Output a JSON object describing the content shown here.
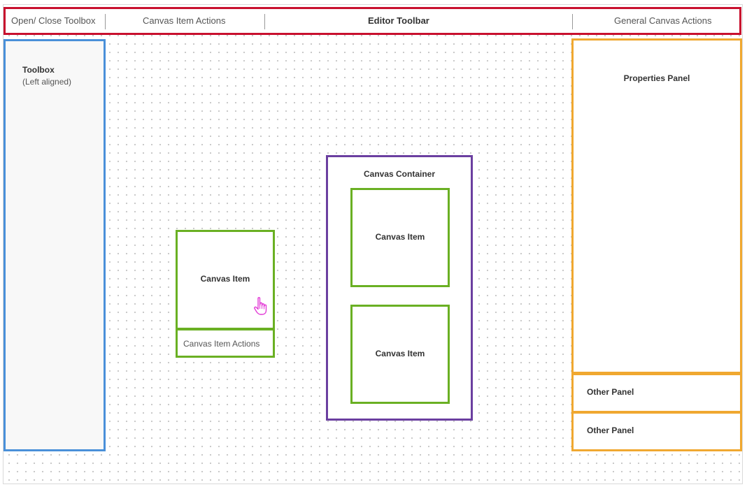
{
  "toolbar": {
    "open_close_toolbox": "Open/ Close Toolbox",
    "canvas_item_actions": "Canvas Item Actions",
    "editor_toolbar": "Editor Toolbar",
    "general_canvas_actions": "General Canvas Actions"
  },
  "toolbox": {
    "title": "Toolbox",
    "subtitle": "(Left aligned)"
  },
  "properties_panel": {
    "title": "Properties Panel"
  },
  "other_panels": [
    "Other Panel",
    "Other Panel"
  ],
  "canvas": {
    "item_label": "Canvas Item",
    "item_actions_label": "Canvas Item Actions",
    "container_title": "Canvas Container",
    "container_items": [
      "Canvas Item",
      "Canvas Item"
    ],
    "cursor_icon": "pointer-hand-icon"
  },
  "colors": {
    "toolbar_border": "#c8102e",
    "toolbox_border": "#4a90d9",
    "panel_border": "#f0a830",
    "item_border": "#6ab023",
    "container_border": "#6b3fa0",
    "cursor": "#e23bd6"
  }
}
